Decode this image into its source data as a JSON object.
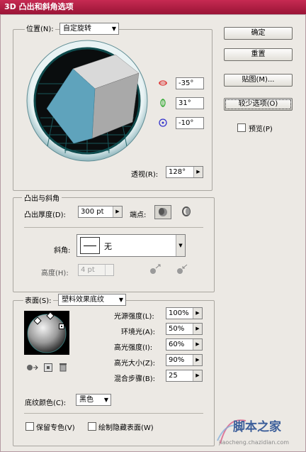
{
  "title": "3D 凸出和斜角选项",
  "position": {
    "label": "位置(N):",
    "value": "自定旋转"
  },
  "rotation": {
    "x": "-35°",
    "y": "31°",
    "z": "-10°"
  },
  "perspective": {
    "label": "透视(R):",
    "value": "128°"
  },
  "buttons": {
    "ok": "确定",
    "reset": "重置",
    "map": "贴图(M)...",
    "fewer": "较少选项(O)",
    "preview": "预览(P)"
  },
  "extrude": {
    "section": "凸出与斜角",
    "depth_label": "凸出厚度(D):",
    "depth_value": "300 pt",
    "cap_label": "端点:",
    "bevel_label": "斜角:",
    "bevel_value": "无",
    "height_label": "高度(H):",
    "height_value": "4 pt"
  },
  "surface": {
    "label": "表面(S):",
    "value": "塑料效果底纹",
    "light_intensity_label": "光源强度(L):",
    "light_intensity_value": "100%",
    "ambient_label": "环境光(A):",
    "ambient_value": "50%",
    "highlight_intensity_label": "高光强度(I):",
    "highlight_intensity_value": "60%",
    "highlight_size_label": "高光大小(Z):",
    "highlight_size_value": "90%",
    "blend_steps_label": "混合步骤(B):",
    "blend_steps_value": "25",
    "shade_color_label": "底纹颜色(C):",
    "shade_color_value": "黑色"
  },
  "checkboxes": {
    "preserve_spot": "保留专色(V)",
    "draw_hidden": "绘制隐藏表面(W)"
  },
  "watermark": {
    "main": "脚本之家",
    "sub": "jiaocheng.chazidian.com"
  },
  "colors": {
    "title_bar": "#b81f48",
    "cube_front": "#5fa3bc",
    "cube_top": "#d9d9d9",
    "cube_side": "#a9a9a9",
    "track_ring": "#0e4a4c"
  }
}
